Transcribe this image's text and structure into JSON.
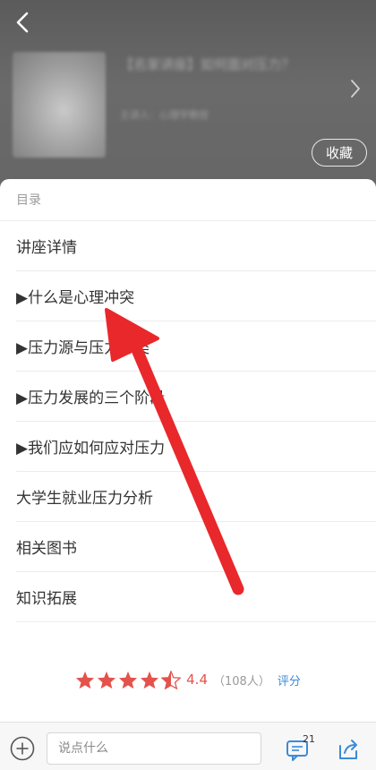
{
  "header": {
    "favorite_label": "收藏",
    "title_blurred": "【名家讲座】如何面对压力？",
    "subtitle_blurred": "主讲人：心理学教授"
  },
  "toc": {
    "heading": "目录",
    "items": [
      "讲座详情",
      "▶什么是心理冲突",
      "▶压力源与压力种类",
      "▶压力发展的三个阶段",
      "▶我们应如何应对压力",
      "大学生就业压力分析",
      "相关图书",
      "知识拓展"
    ]
  },
  "rating": {
    "stars": 4.5,
    "value": "4.4",
    "count": "（108人）",
    "rate_label": "评分",
    "star_color": "#e4524c"
  },
  "bottom": {
    "comment_placeholder": "说点什么",
    "comment_count": "21"
  },
  "colors": {
    "accent_red": "#e8282b",
    "link_blue": "#3a8bd8"
  }
}
